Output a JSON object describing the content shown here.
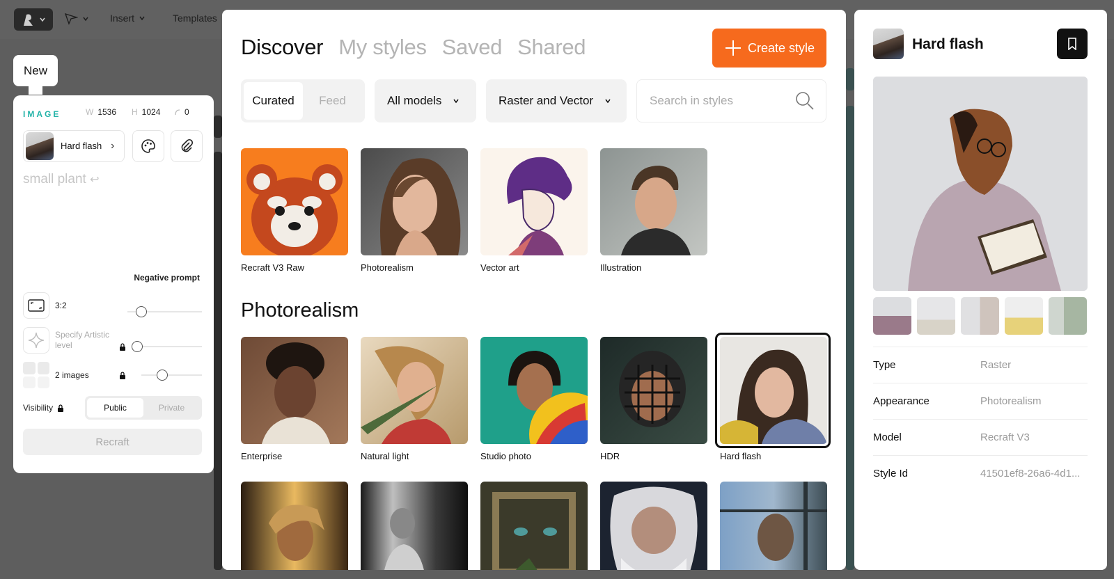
{
  "toolbar": {
    "insert": "Insert",
    "templates": "Templates"
  },
  "left_panel": {
    "new_label": "New",
    "section_label": "IMAGE",
    "width_key": "W",
    "width": "1536",
    "height_key": "H",
    "height": "1024",
    "rotation": "0",
    "style_name": "Hard flash",
    "prompt": "small plant",
    "negative_prompt_label": "Negative prompt",
    "aspect_ratio": "3:2",
    "artistic_level_label": "Specify Artistic level",
    "images_count": "2 images",
    "visibility_label": "Visibility",
    "visibility_options": [
      "Public",
      "Private"
    ],
    "visibility_selected": "Public",
    "recraft_button": "Recraft"
  },
  "modal": {
    "tabs": [
      "Discover",
      "My styles",
      "Saved",
      "Shared"
    ],
    "active_tab": "Discover",
    "create_button": "Create style",
    "segment": [
      "Curated",
      "Feed"
    ],
    "segment_selected": "Curated",
    "model_filter": "All models",
    "type_filter": "Raster and Vector",
    "search_placeholder": "Search in styles",
    "featured": [
      "Recraft V3 Raw",
      "Photorealism",
      "Vector art",
      "Illustration"
    ],
    "section_title": "Photorealism",
    "photo_styles": [
      "Enterprise",
      "Natural light",
      "Studio photo",
      "HDR",
      "Hard flash"
    ],
    "selected_style": "Hard flash"
  },
  "detail": {
    "title": "Hard flash",
    "props": [
      {
        "key": "Type",
        "value": "Raster"
      },
      {
        "key": "Appearance",
        "value": "Photorealism"
      },
      {
        "key": "Model",
        "value": "Recraft V3"
      },
      {
        "key": "Style Id",
        "value": "41501ef8-26a6-4d1..."
      }
    ]
  },
  "colors": {
    "accent": "#f66a1d",
    "teal": "#23b3a8"
  }
}
